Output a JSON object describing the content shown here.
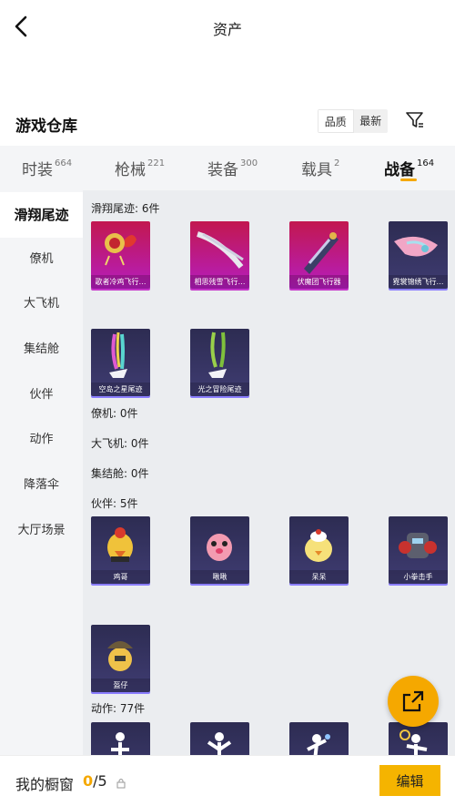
{
  "header": {
    "title": "资产"
  },
  "section": {
    "title": "游戏仓库"
  },
  "sort": {
    "options": [
      "品质",
      "最新"
    ],
    "selected": "品质"
  },
  "tabs": [
    {
      "label": "时装",
      "count": "664"
    },
    {
      "label": "枪械",
      "count": "221"
    },
    {
      "label": "装备",
      "count": "300"
    },
    {
      "label": "载具",
      "count": "2"
    },
    {
      "label": "战备",
      "count": "164",
      "active": true
    }
  ],
  "sidebar": {
    "items": [
      "滑翔尾迹",
      "僚机",
      "大飞机",
      "集结舱",
      "伙伴",
      "动作",
      "降落伞",
      "大厅场景"
    ],
    "active": "滑翔尾迹"
  },
  "groups": [
    {
      "label": "滑翔尾迹: 6件",
      "items": [
        "歌者冷鸡飞行…",
        "相思残雪飞行…",
        "伏魔团飞行器",
        "霓裳锦绣飞行…",
        "空岛之星尾迹",
        "光之冒险尾迹"
      ]
    },
    {
      "label": "僚机: 0件",
      "items": []
    },
    {
      "label": "大飞机: 0件",
      "items": []
    },
    {
      "label": "集结舱: 0件",
      "items": []
    },
    {
      "label": "伙伴: 5件",
      "items": [
        "鸡哥",
        "啾啾",
        "呆呆",
        "小拳击手",
        "盔仔"
      ]
    },
    {
      "label": "动作: 77件",
      "items": [
        "",
        "",
        "",
        ""
      ]
    }
  ],
  "bottom": {
    "label": "我的橱窗",
    "current": "0",
    "total": "/5",
    "edit_label": "编辑"
  },
  "colors": {
    "accent": "#f5a800",
    "pink_card": "#c2184f",
    "purple_card": "#2d2c52"
  }
}
